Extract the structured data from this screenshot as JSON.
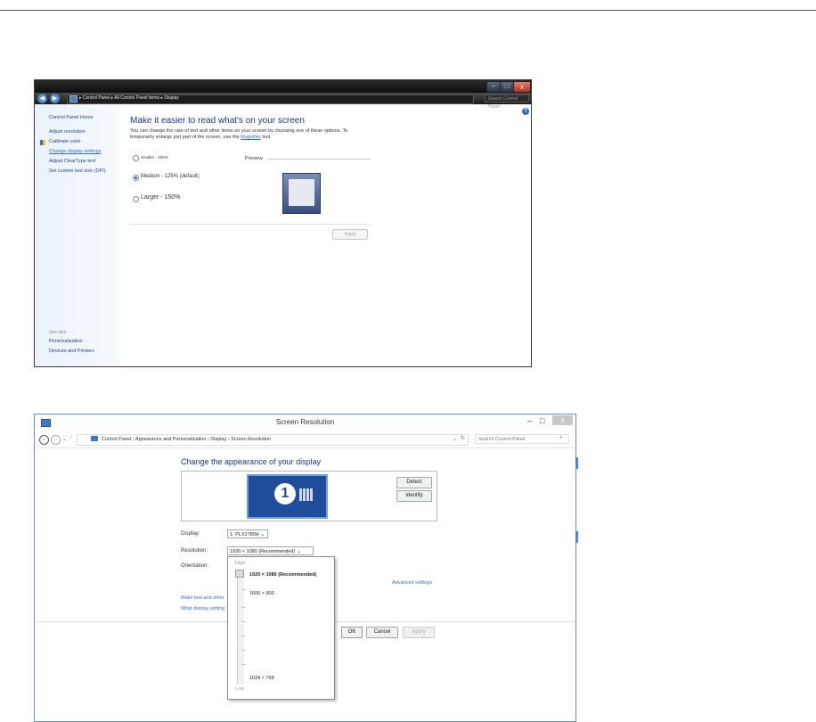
{
  "win7": {
    "breadcrumb": [
      "Control Panel",
      "All Control Panel Items",
      "Display"
    ],
    "caption_min": "–",
    "caption_max": "□",
    "caption_close": "x",
    "search_placeholder": "Search Control Panel",
    "sidebar": {
      "home": "Control Panel Home",
      "links": [
        "Adjust resolution",
        "Calibrate color",
        "Change display settings",
        "Adjust ClearType text",
        "Set custom text size (DPI)"
      ],
      "see_also_label": "See also",
      "see_also": [
        "Personalization",
        "Devices and Printers"
      ]
    },
    "heading": "Make it easier to read what's on your screen",
    "description_1": "You can change the size of text and other items on your screen by choosing one of these options. To temporarily enlarge just part of the screen, use the ",
    "magnifier_link": "Magnifier",
    "description_2": " tool.",
    "options": [
      {
        "label": "Smaller - 100%",
        "selected": false
      },
      {
        "label": "Medium - 125% (default)",
        "selected": true
      },
      {
        "label": "Larger - 150%",
        "selected": false
      }
    ],
    "preview_label": "Preview",
    "apply_label": "Apply",
    "help_glyph": "?"
  },
  "win8": {
    "title": "Screen Resolution",
    "min_glyph": "–",
    "max_glyph": "□",
    "close_glyph": "x",
    "breadcrumb": "Control Panel  ›  Appearance and Personalization  ›  Display  ›  Screen Resolution",
    "search_placeholder": "Search Control Panel",
    "heading": "Change the appearance of your display",
    "monitor_number": "1",
    "detect_label": "Detect",
    "identify_label": "Identify",
    "display_label": "Display:",
    "display_value": "1. PLX2780H",
    "resolution_label": "Resolution:",
    "resolution_value": "1920 × 1080 (Recommended)",
    "orientation_label": "Orientation:",
    "advanced_link": "Advanced settings",
    "make_text_link": "Make text and other",
    "what_display_link": "What display setting",
    "ok_label": "OK",
    "cancel_label": "Cancel",
    "apply_label": "Apply",
    "dropdown": {
      "high_label": "High",
      "low_label": "Low",
      "items": [
        "1920 × 1080 (Recommended)",
        "1600 × 900",
        "1024 × 768"
      ],
      "level": 1.0
    }
  }
}
